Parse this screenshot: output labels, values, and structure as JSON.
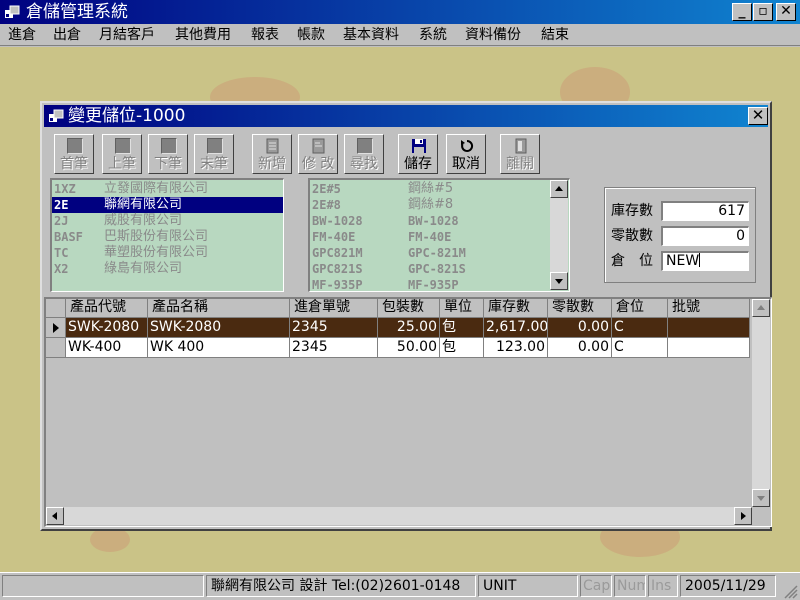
{
  "window": {
    "title": "倉儲管理系統",
    "minimize_label": "_",
    "restore_label": "▫",
    "close_label": "✕"
  },
  "menu": {
    "items": [
      "進倉",
      "出倉",
      "月結客戶",
      "其他費用",
      "報表",
      "帳款",
      "基本資料",
      "系統",
      "資料備份",
      "結束"
    ]
  },
  "dialog": {
    "title": "變更儲位-1000",
    "close_label": "✕"
  },
  "toolbar": {
    "buttons": [
      {
        "label": "首筆",
        "icon": "first-record-icon",
        "enabled": false
      },
      {
        "label": "上筆",
        "icon": "previous-record-icon",
        "enabled": false
      },
      {
        "label": "下筆",
        "icon": "next-record-icon",
        "enabled": false
      },
      {
        "label": "末筆",
        "icon": "last-record-icon",
        "enabled": false
      },
      {
        "label": "新增",
        "icon": "new-record-icon",
        "enabled": false
      },
      {
        "label": "修 改",
        "icon": "edit-record-icon",
        "enabled": false
      },
      {
        "label": "尋找",
        "icon": "find-icon",
        "enabled": false
      },
      {
        "label": "儲存",
        "icon": "save-disk-icon",
        "enabled": true
      },
      {
        "label": "取消",
        "icon": "undo-icon",
        "enabled": true
      },
      {
        "label": "離開",
        "icon": "exit-icon",
        "enabled": false
      }
    ]
  },
  "customer_list": {
    "rows": [
      {
        "code": "1XZ",
        "name": "立發國際有限公司",
        "selected": false
      },
      {
        "code": "2E",
        "name": "聯網有限公司",
        "selected": true
      },
      {
        "code": "2J",
        "name": "威股有限公司",
        "selected": false
      },
      {
        "code": "BASF",
        "name": "巴斯股份有限公司",
        "selected": false
      },
      {
        "code": "TC",
        "name": "華塑股份有限公司",
        "selected": false
      },
      {
        "code": "X2",
        "name": "綠島有限公司",
        "selected": false
      }
    ]
  },
  "product_list": {
    "rows": [
      {
        "code": "2E#5",
        "name": "鋼絲#5"
      },
      {
        "code": "2E#8",
        "name": "鋼絲#8"
      },
      {
        "code": "BW-1028",
        "name": "BW-1028"
      },
      {
        "code": "FM-40E",
        "name": "FM-40E"
      },
      {
        "code": "GPC821M",
        "name": "GPC-821M"
      },
      {
        "code": "GPC821S",
        "name": "GPC-821S"
      },
      {
        "code": "MF-935P",
        "name": "MF-935P"
      }
    ]
  },
  "stock": {
    "stock_label": "庫存數",
    "stock_value": "617",
    "loose_label": "零散數",
    "loose_value": "0",
    "location_label": "倉　位",
    "location_value": "NEW"
  },
  "grid": {
    "columns": [
      "產品代號",
      "產品名稱",
      "進倉單號",
      "包裝數",
      "單位",
      "庫存數",
      "零散數",
      "倉位",
      "批號"
    ],
    "rows": [
      {
        "current": true,
        "cells": [
          "SWK-2080",
          "SWK-2080",
          "2345",
          "25.00",
          "包",
          "2,617.00",
          "0.00",
          "C",
          ""
        ]
      },
      {
        "current": false,
        "cells": [
          "WK-400",
          "WK 400",
          "2345",
          "50.00",
          "包",
          "123.00",
          "0.00",
          "C",
          ""
        ]
      }
    ]
  },
  "status": {
    "panel1": "",
    "company": "聯網有限公司 設計 Tel:(02)2601-0148",
    "unit": "UNIT",
    "caps": "Caps",
    "num": "Num",
    "ins": "Ins",
    "date": "2005/11/29"
  },
  "colors": {
    "title_bar": "#000080",
    "list_background": "#b8d8c0",
    "selected_row": "#4a2a10",
    "desktop": "#cac387"
  }
}
